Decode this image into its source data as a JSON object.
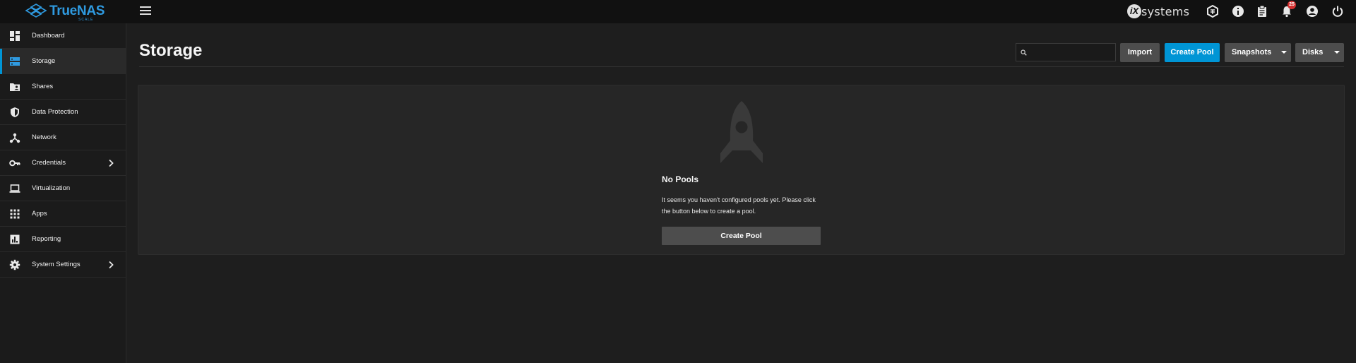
{
  "app": {
    "brand_name": "TrueNAS",
    "brand_edition": "SCALE",
    "vendor": "systems",
    "vendor_mark": "iX",
    "notification_count": "25"
  },
  "topbar_icons": [
    "truecommand-icon",
    "info-icon",
    "clipboard-icon",
    "bell-icon",
    "account-circle-icon",
    "power-icon"
  ],
  "sidebar": {
    "items": [
      {
        "label": "Dashboard",
        "icon": "dashboard-icon",
        "active": false,
        "has_children": false
      },
      {
        "label": "Storage",
        "icon": "storage-icon",
        "active": true,
        "has_children": false
      },
      {
        "label": "Shares",
        "icon": "folder-shared-icon",
        "active": false,
        "has_children": false
      },
      {
        "label": "Data Protection",
        "icon": "shield-icon",
        "active": false,
        "has_children": false
      },
      {
        "label": "Network",
        "icon": "network-icon",
        "active": false,
        "has_children": false
      },
      {
        "label": "Credentials",
        "icon": "key-icon",
        "active": false,
        "has_children": true
      },
      {
        "label": "Virtualization",
        "icon": "laptop-icon",
        "active": false,
        "has_children": false
      },
      {
        "label": "Apps",
        "icon": "apps-grid-icon",
        "active": false,
        "has_children": false
      },
      {
        "label": "Reporting",
        "icon": "chart-icon",
        "active": false,
        "has_children": false
      },
      {
        "label": "System Settings",
        "icon": "gear-icon",
        "active": false,
        "has_children": true
      }
    ]
  },
  "page": {
    "title": "Storage",
    "search_value": "",
    "actions": {
      "import": "Import",
      "create_pool": "Create Pool",
      "snapshots": "Snapshots",
      "disks": "Disks"
    }
  },
  "empty_state": {
    "icon": "rocket-icon",
    "title": "No Pools",
    "message": "It seems you haven't configured pools yet. Please click the button below to create a pool.",
    "button": "Create Pool"
  },
  "colors": {
    "accent": "#0095d5",
    "brand": "#2f9ae0",
    "background": "#1e1e1e",
    "card": "#262626",
    "badge": "#d32f2f"
  }
}
